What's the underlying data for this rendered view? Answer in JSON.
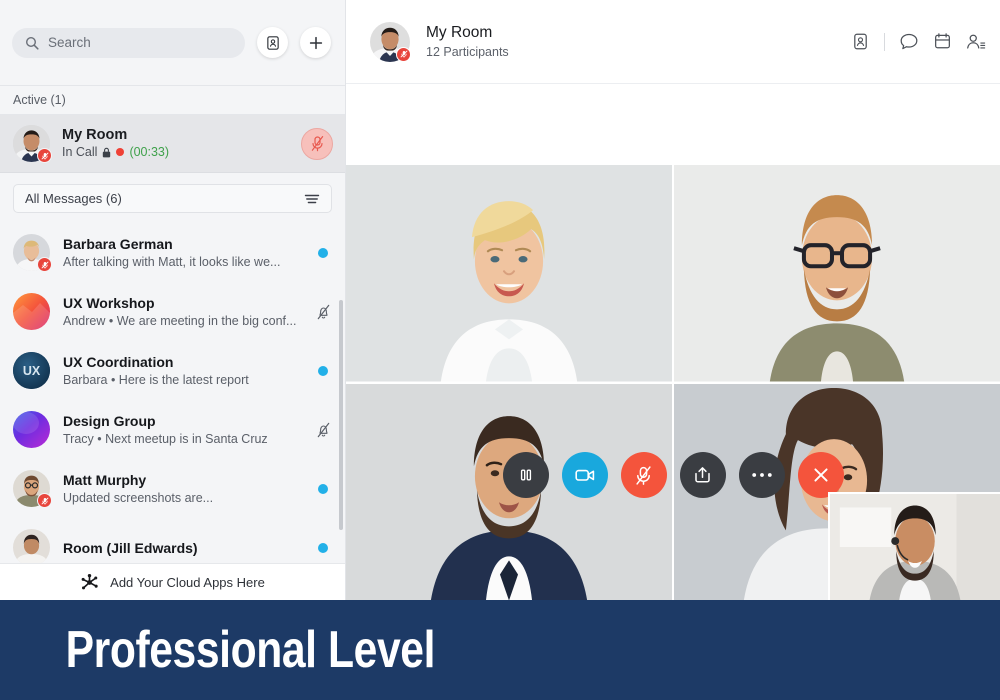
{
  "sidebar": {
    "search": {
      "placeholder": "Search",
      "icon": "search-icon"
    },
    "contacts_button_icon": "contact-card-icon",
    "add_button_icon": "plus-icon",
    "active_header": "Active (1)",
    "active_room": {
      "title": "My Room",
      "status": "In Call",
      "lock_icon": "lock-icon",
      "recording_icon": "record-dot-icon",
      "timer": "(00:33)",
      "timer_color": "#3fa14b",
      "mute_button_icon": "mic-muted-icon",
      "mute_button_color": "#f7c0bb"
    },
    "filter": {
      "label": "All Messages (6)",
      "icon": "filter-lines-icon"
    },
    "messages": [
      {
        "name": "Barbara German",
        "preview": "After talking with Matt, it looks like we...",
        "avatar_type": "photo-woman-blonde",
        "avatar_color": "#d6d8dc",
        "has_mute_badge": true,
        "right_icon": "unread-dot",
        "unread_color": "#22b0e8"
      },
      {
        "name": "UX Workshop",
        "preview": "Andrew • We are meeting in the big conf...",
        "avatar_type": "gradient-orange-pink",
        "avatar_color": "#f0603c",
        "has_mute_badge": false,
        "right_icon": "bell-muted-icon"
      },
      {
        "name": "UX Coordination",
        "preview": "Barbara • Here is the latest report",
        "avatar_type": "initials",
        "avatar_initials": "UX",
        "avatar_color": "#163f63",
        "has_mute_badge": false,
        "right_icon": "unread-dot",
        "unread_color": "#22b0e8"
      },
      {
        "name": "Design Group",
        "preview": "Tracy • Next meetup is in Santa Cruz",
        "avatar_type": "gradient-blue-purple",
        "avatar_color": "#5b2bd6",
        "has_mute_badge": false,
        "right_icon": "bell-muted-icon"
      },
      {
        "name": "Matt Murphy",
        "preview": "Updated screenshots are...",
        "avatar_type": "photo-man-beard",
        "avatar_color": "#d9d6d0",
        "has_mute_badge": true,
        "right_icon": "unread-dot",
        "unread_color": "#22b0e8"
      },
      {
        "name": "Room (Jill Edwards)",
        "preview": "",
        "avatar_type": "photo-woman-dark",
        "avatar_color": "#ddd9d6",
        "has_mute_badge": false,
        "right_icon": "unread-dot",
        "unread_color": "#22b0e8"
      }
    ],
    "cloud_apps": {
      "label": "Add Your Cloud Apps Here",
      "icon": "cloud-apps-starburst-icon"
    }
  },
  "main": {
    "header": {
      "room_title": "My Room",
      "participants": "12 Participants",
      "avatar_type": "photo-man-beard-dark",
      "has_mute_badge": true,
      "icons": [
        {
          "name": "contact-card-icon"
        },
        {
          "name": "chat-bubble-icon"
        },
        {
          "name": "calendar-icon"
        },
        {
          "name": "participants-list-icon"
        }
      ]
    },
    "video_tiles": [
      {
        "participant": "blonde-woman-white-shirt",
        "bg": "#dfe2e3"
      },
      {
        "participant": "bearded-man-glasses",
        "bg": "#e9eaea"
      },
      {
        "participant": "man-blue-suit",
        "bg": "#d9dadb"
      },
      {
        "participant": "young-woman-dark-hair",
        "bg": "#c9cdd1"
      }
    ],
    "call_controls": [
      {
        "name": "hold-button",
        "icon": "pause-icon",
        "style": "dark",
        "color": "#3a3d42"
      },
      {
        "name": "video-button",
        "icon": "video-camera-icon",
        "style": "blue",
        "color": "#19a8dd"
      },
      {
        "name": "mute-button",
        "icon": "mic-muted-icon",
        "style": "red",
        "color": "#f4543c"
      },
      {
        "name": "share-screen-button",
        "icon": "share-upload-icon",
        "style": "dark",
        "color": "#3a3d42"
      },
      {
        "name": "more-options-button",
        "icon": "ellipsis-icon",
        "style": "dark",
        "color": "#3a3d42"
      },
      {
        "name": "end-call-button",
        "icon": "close-x-icon",
        "style": "red",
        "color": "#f4543c"
      }
    ],
    "self_view": {
      "participant": "man-grey-blazer-headset",
      "bg": "#e6e6e4"
    }
  },
  "banner": {
    "text": "Professional Level",
    "bg_color": "#1d3a66",
    "text_color": "#ffffff"
  }
}
